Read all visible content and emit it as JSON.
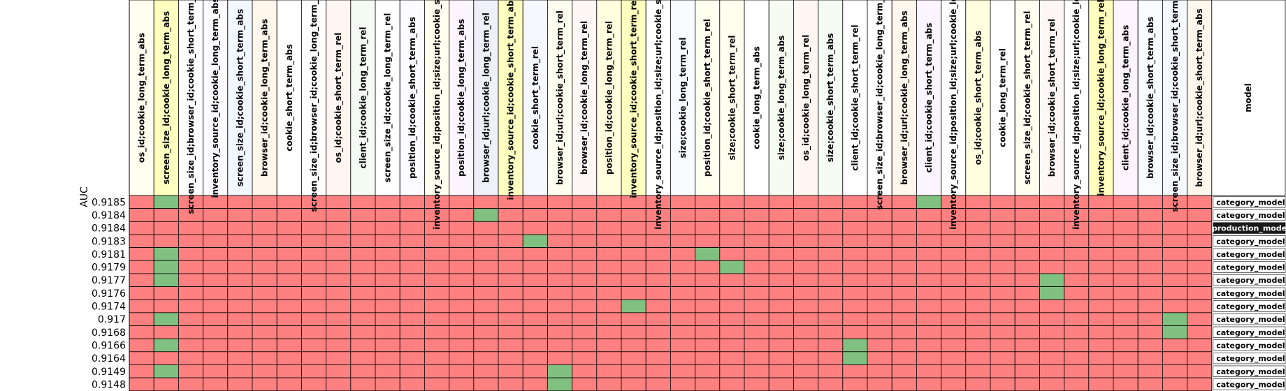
{
  "chart_data": {
    "type": "heatmap",
    "ylabel": "AUC",
    "model_header": "model",
    "colors": {
      "included": "#80c080",
      "excluded": "#ff8080",
      "grid": "#000000",
      "production_bg": "#1a1a1a",
      "production_text": "#ffffff",
      "model_bg": "#ffffff",
      "model_text": "#000000"
    },
    "columns": [
      {
        "name": "os_id;cookie_long_term_abs",
        "tint": "#fffff0"
      },
      {
        "name": "screen_size_id;cookie_long_term_abs",
        "tint": "#ffffc0"
      },
      {
        "name": "screen_size_id;browser_id;cookie_short_term_abs",
        "tint": "#ffffff"
      },
      {
        "name": "inventory_source_id;cookie_long_term_abs",
        "tint": "#fafaff"
      },
      {
        "name": "screen_size_id;cookie_short_term_abs",
        "tint": "#f2f8ff"
      },
      {
        "name": "browser_id;cookie_long_term_abs",
        "tint": "#fff6ec"
      },
      {
        "name": "cookie_short_term_abs",
        "tint": "#ffffff"
      },
      {
        "name": "screen_size_id;browser_id;cookie_long_term_abs",
        "tint": "#ffffff"
      },
      {
        "name": "os_id;cookie_short_term_rel",
        "tint": "#fff6f2"
      },
      {
        "name": "client_id;cookie_long_term_rel",
        "tint": "#f4fbf2"
      },
      {
        "name": "screen_size_id;cookie_long_term_rel",
        "tint": "#ffffff"
      },
      {
        "name": "position_id;cookie_short_term_abs",
        "tint": "#fafaff"
      },
      {
        "name": "inventory_source_id;position_id;size;url;cookie_short_te",
        "tint": "#fffff0"
      },
      {
        "name": "position_id;cookie_long_term_abs",
        "tint": "#fcf4ff"
      },
      {
        "name": "browser_id;url;cookie_long_term_rel",
        "tint": "#f0f0fa"
      },
      {
        "name": "inventory_source_id;cookie_short_term_abs",
        "tint": "#ffffc0"
      },
      {
        "name": "cookie_short_term_rel",
        "tint": "#f6f8ff"
      },
      {
        "name": "browser_id;url;cookie_short_term_rel",
        "tint": "#fffff0"
      },
      {
        "name": "browser_id;cookie_long_term_rel",
        "tint": "#fff6f6"
      },
      {
        "name": "position_id;cookie_long_term_rel",
        "tint": "#ffffe0"
      },
      {
        "name": "inventory_source_id;cookie_short_term_rel",
        "tint": "#ffffc0"
      },
      {
        "name": "inventory_source_id;position_id;size;url;cookie_short_te",
        "tint": "#ffffff"
      },
      {
        "name": "size;cookie_long_term_rel",
        "tint": "#f8fbff"
      },
      {
        "name": "position_id;cookie_short_term_rel",
        "tint": "#fffff0"
      },
      {
        "name": "size;cookie_short_term_rel",
        "tint": "#fffff0"
      },
      {
        "name": "cookie_long_term_abs",
        "tint": "#ffffff"
      },
      {
        "name": "size;cookie_long_term_abs",
        "tint": "#f6fcf2"
      },
      {
        "name": "os_id;cookie_long_term_rel",
        "tint": "#fff6f2"
      },
      {
        "name": "size;cookie_short_term_abs",
        "tint": "#f4fcf4"
      },
      {
        "name": "client_id;cookie_short_term_rel",
        "tint": "#ffffff"
      },
      {
        "name": "screen_size_id;browser_id;cookie_long_term_rel",
        "tint": "#ffffff"
      },
      {
        "name": "browser_id;url;cookie_long_term_abs",
        "tint": "#fff6ec"
      },
      {
        "name": "client_id;cookie_short_term_abs",
        "tint": "#fcf4ff"
      },
      {
        "name": "inventory_source_id;position_id;size;url;cookie_long_ter",
        "tint": "#ffffff"
      },
      {
        "name": "os_id;cookie_short_term_abs",
        "tint": "#ffffe0"
      },
      {
        "name": "cookie_long_term_rel",
        "tint": "#ffffff"
      },
      {
        "name": "screen_size_id;cookie_short_term_rel",
        "tint": "#fffff0"
      },
      {
        "name": "browser_id;cookie_short_term_rel",
        "tint": "#fff6f6"
      },
      {
        "name": "inventory_source_id;position_id;size;url;cookie_long_ter",
        "tint": "#ffffff"
      },
      {
        "name": "inventory_source_id;cookie_long_term_rel",
        "tint": "#ffffc0"
      },
      {
        "name": "client_id;cookie_long_term_abs",
        "tint": "#fcf4ff"
      },
      {
        "name": "browser_id;cookie_short_term_abs",
        "tint": "#f8fbff"
      },
      {
        "name": "screen_size_id;browser_id;cookie_short_term_rel",
        "tint": "#f4f8ff"
      },
      {
        "name": "browser_id;url;cookie_short_term_abs",
        "tint": "#fff6ec"
      }
    ],
    "rows": [
      {
        "auc": "0.9185",
        "model": "category_model",
        "production": false,
        "included": [
          1,
          32
        ]
      },
      {
        "auc": "0.9184",
        "model": "category_model",
        "production": false,
        "included": [
          14
        ]
      },
      {
        "auc": "0.9184",
        "model": "production_model",
        "production": true,
        "included": []
      },
      {
        "auc": "0.9183",
        "model": "category_model",
        "production": false,
        "included": [
          16
        ]
      },
      {
        "auc": "0.9181",
        "model": "category_model",
        "production": false,
        "included": [
          1,
          23
        ]
      },
      {
        "auc": "0.9179",
        "model": "category_model",
        "production": false,
        "included": [
          1,
          24
        ]
      },
      {
        "auc": "0.9177",
        "model": "category_model",
        "production": false,
        "included": [
          1,
          37
        ]
      },
      {
        "auc": "0.9176",
        "model": "category_model",
        "production": false,
        "included": [
          37
        ]
      },
      {
        "auc": "0.9174",
        "model": "category_model",
        "production": false,
        "included": [
          20
        ]
      },
      {
        "auc": "0.917",
        "model": "category_model",
        "production": false,
        "included": [
          1,
          42
        ]
      },
      {
        "auc": "0.9168",
        "model": "category_model",
        "production": false,
        "included": [
          42
        ]
      },
      {
        "auc": "0.9166",
        "model": "category_model",
        "production": false,
        "included": [
          1,
          29
        ]
      },
      {
        "auc": "0.9164",
        "model": "category_model",
        "production": false,
        "included": [
          29
        ]
      },
      {
        "auc": "0.9149",
        "model": "category_model",
        "production": false,
        "included": [
          1,
          17
        ]
      },
      {
        "auc": "0.9148",
        "model": "category_model",
        "production": false,
        "included": [
          17
        ]
      }
    ]
  }
}
